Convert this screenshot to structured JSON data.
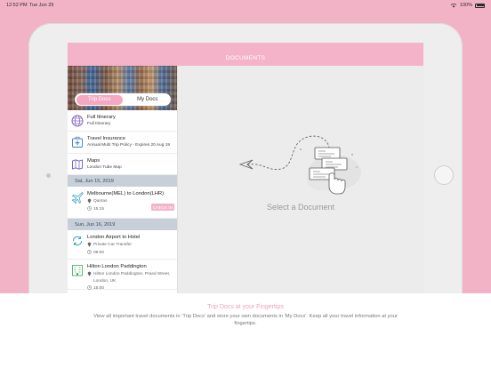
{
  "status_bar": {
    "time": "12:52 PM",
    "date": "Tue Jun 29",
    "battery": "100%"
  },
  "app": {
    "title": "DOCUMENTS",
    "segments": [
      "Trip Docs",
      "My Docs"
    ],
    "active_segment": "Trip Docs",
    "items": [
      {
        "icon": "globe-icon",
        "title": "Full Itinerary",
        "subtitle": "Full Itinerary"
      },
      {
        "icon": "medical-kit-icon",
        "title": "Travel Insurance",
        "subtitle": "Annual Multi Trip Policy - Expires 20 Aug 19"
      },
      {
        "icon": "map-icon",
        "title": "Maps",
        "subtitle": "London Tube Map"
      }
    ],
    "sections": [
      {
        "label": "Sat, Jun 15, 2019",
        "items": [
          {
            "icon": "plane-icon",
            "title": "Melbourne(MEL) to London(LHR)",
            "location": "Qantas",
            "time": "15:15",
            "action": "CHECK IN"
          }
        ]
      },
      {
        "label": "Sun, Jun 16, 2019",
        "items": [
          {
            "icon": "transfer-icon",
            "title": "London Airport to Hotel",
            "location": "Private Car Transfer",
            "time": "09:00"
          },
          {
            "icon": "hotel-icon",
            "title": "Hilton London Paddington",
            "address_line1": "Hilton London Paddington, Praed Street,",
            "address_line2": "London, UK",
            "time": "15:00"
          }
        ]
      }
    ],
    "empty_state": "Select a Document"
  },
  "footer": {
    "title": "Trip Docs at your Fingertips",
    "description": "View all important travel documents in 'Trip Docs' and store your own documents in 'My Docs'. Keep all your travel information at your fingertips."
  },
  "colors": {
    "accent": "#f4b3c8",
    "background": "#f3b3c6",
    "section_header": "#c7cfd9"
  }
}
